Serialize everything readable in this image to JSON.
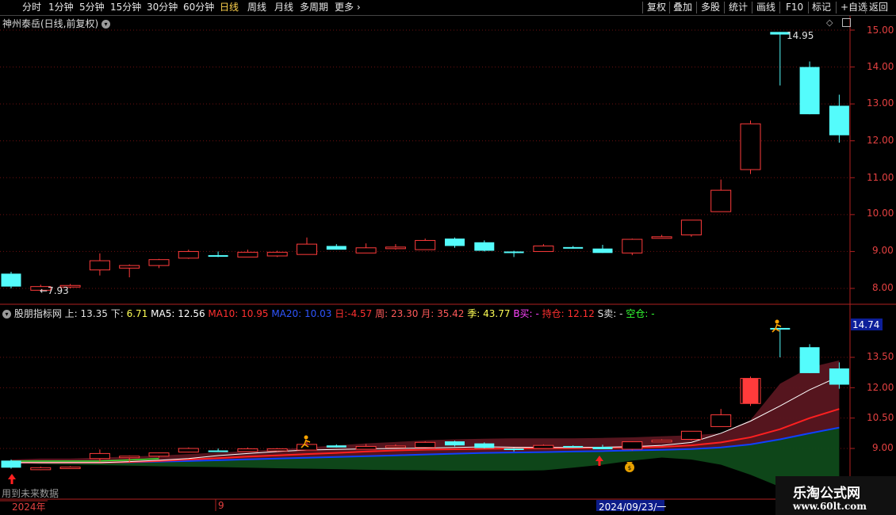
{
  "toolbar": {
    "periods": [
      "分时",
      "1分钟",
      "5分钟",
      "15分钟",
      "30分钟",
      "60分钟",
      "日线",
      "周线",
      "月线",
      "多周期",
      "更多"
    ],
    "active_period": "日线",
    "more_arrow": "›",
    "actions": [
      "复权",
      "叠加",
      "多股",
      "统计",
      "画线",
      "F10",
      "+自选",
      "返回"
    ],
    "mark_label": "标记"
  },
  "main_panel": {
    "title": "神州泰岳(日线,前复权)",
    "high_label": "14.95",
    "low_label": "←7.93",
    "y_ticks": [
      "15.00",
      "14.00",
      "13.00",
      "12.00",
      "11.00",
      "10.00",
      "9.00",
      "8.00"
    ]
  },
  "indicator_panel": {
    "name": "股朋指标网",
    "items": [
      {
        "k": "上:",
        "v": "13.35"
      },
      {
        "k": "下:",
        "v": "6.71"
      },
      {
        "k": "MA5:",
        "v": "12.56"
      },
      {
        "k": "MA10:",
        "v": "10.95"
      },
      {
        "k": "MA20:",
        "v": "10.03"
      },
      {
        "k": "日:",
        "v": "-4.57"
      },
      {
        "k": "周:",
        "v": "23.30"
      },
      {
        "k": "月:",
        "v": "35.42"
      },
      {
        "k": "季:",
        "v": "43.77"
      },
      {
        "k": "B买:",
        "v": "-"
      },
      {
        "k": "持仓:",
        "v": "12.12"
      },
      {
        "k": "S卖:",
        "v": "-"
      },
      {
        "k": "空仓:",
        "v": "-"
      }
    ],
    "current_price": "14.74",
    "y_ticks": [
      "13.50",
      "12.00",
      "10.50",
      "9.00"
    ],
    "footer_note": "用到未来数据"
  },
  "time_axis": {
    "year_label": "2024年",
    "month_label": "9",
    "date_label": "2024/09/23/一"
  },
  "watermark": {
    "title": "乐淘公式网",
    "url": "www.60lt.com"
  },
  "colors": {
    "up": "#ff3b3b",
    "down": "#54fcfc",
    "grid": "#6e1010",
    "ma5": "#ffffff",
    "ma10": "#ff2020",
    "ma20": "#1040ff"
  },
  "chart_data": {
    "type": "candlestick",
    "ylim": [
      7.6,
      15.3
    ],
    "candles": [
      {
        "o": 8.4,
        "c": 8.05,
        "h": 8.45,
        "l": 8.0
      },
      {
        "o": 7.95,
        "c": 8.05,
        "h": 8.1,
        "l": 7.93
      },
      {
        "o": 8.05,
        "c": 8.08,
        "h": 8.12,
        "l": 8.0
      },
      {
        "o": 8.5,
        "c": 8.75,
        "h": 8.95,
        "l": 8.35
      },
      {
        "o": 8.55,
        "c": 8.62,
        "h": 8.65,
        "l": 8.3
      },
      {
        "o": 8.62,
        "c": 8.78,
        "h": 8.8,
        "l": 8.55
      },
      {
        "o": 8.82,
        "c": 9.0,
        "h": 9.05,
        "l": 8.8
      },
      {
        "o": 8.9,
        "c": 8.86,
        "h": 9.0,
        "l": 8.85
      },
      {
        "o": 8.85,
        "c": 8.98,
        "h": 9.05,
        "l": 8.85
      },
      {
        "o": 8.88,
        "c": 8.98,
        "h": 9.02,
        "l": 8.85
      },
      {
        "o": 8.92,
        "c": 9.2,
        "h": 9.38,
        "l": 8.92
      },
      {
        "o": 9.15,
        "c": 9.05,
        "h": 9.2,
        "l": 9.05
      },
      {
        "o": 8.96,
        "c": 9.1,
        "h": 9.22,
        "l": 8.96
      },
      {
        "o": 9.08,
        "c": 9.12,
        "h": 9.2,
        "l": 9.05
      },
      {
        "o": 9.05,
        "c": 9.3,
        "h": 9.35,
        "l": 9.05
      },
      {
        "o": 9.35,
        "c": 9.15,
        "h": 9.38,
        "l": 9.1
      },
      {
        "o": 9.25,
        "c": 9.02,
        "h": 9.3,
        "l": 9.0
      },
      {
        "o": 9.0,
        "c": 8.98,
        "h": 9.02,
        "l": 8.85
      },
      {
        "o": 9.0,
        "c": 9.15,
        "h": 9.2,
        "l": 9.0
      },
      {
        "o": 9.12,
        "c": 9.1,
        "h": 9.15,
        "l": 9.08
      },
      {
        "o": 9.08,
        "c": 8.96,
        "h": 9.18,
        "l": 8.96
      },
      {
        "o": 8.96,
        "c": 9.33,
        "h": 9.35,
        "l": 8.9
      },
      {
        "o": 9.38,
        "c": 9.4,
        "h": 9.45,
        "l": 9.38
      },
      {
        "o": 9.45,
        "c": 9.85,
        "h": 9.85,
        "l": 9.4
      },
      {
        "o": 10.08,
        "c": 10.66,
        "h": 10.95,
        "l": 10.08
      },
      {
        "o": 11.22,
        "c": 12.46,
        "h": 12.55,
        "l": 11.1
      },
      {
        "o": 14.95,
        "c": 14.88,
        "h": 14.95,
        "l": 13.5
      },
      {
        "o": 14.0,
        "c": 12.72,
        "h": 14.15,
        "l": 12.72
      },
      {
        "o": 12.95,
        "c": 12.15,
        "h": 13.25,
        "l": 11.95
      }
    ],
    "indicator": {
      "ylim": [
        8.2,
        14.9
      ],
      "ma5": [
        8.3,
        8.3,
        8.3,
        8.3,
        8.35,
        8.42,
        8.5,
        8.65,
        8.75,
        8.85,
        8.92,
        8.95,
        8.98,
        9.0,
        9.02,
        9.05,
        9.08,
        9.06,
        9.05,
        9.05,
        9.06,
        9.09,
        9.15,
        9.3,
        9.75,
        10.35,
        11.1,
        11.9,
        12.56
      ],
      "ma10": [
        8.3,
        8.3,
        8.3,
        8.3,
        8.33,
        8.38,
        8.45,
        8.52,
        8.6,
        8.66,
        8.72,
        8.78,
        8.85,
        8.9,
        8.94,
        8.96,
        8.98,
        9.0,
        9.01,
        9.02,
        9.03,
        9.05,
        9.08,
        9.15,
        9.3,
        9.55,
        9.95,
        10.5,
        10.95
      ],
      "ma20": [
        8.3,
        8.3,
        8.3,
        8.3,
        8.32,
        8.35,
        8.38,
        8.42,
        8.46,
        8.5,
        8.54,
        8.58,
        8.62,
        8.66,
        8.7,
        8.74,
        8.78,
        8.8,
        8.82,
        8.85,
        8.87,
        8.9,
        8.93,
        8.97,
        9.05,
        9.2,
        9.45,
        9.75,
        10.03
      ],
      "upper": [
        8.45,
        8.5,
        8.5,
        8.55,
        8.6,
        8.65,
        8.72,
        8.8,
        8.88,
        8.95,
        9.05,
        9.15,
        9.25,
        9.32,
        9.4,
        9.45,
        9.48,
        9.5,
        9.5,
        9.5,
        9.52,
        9.55,
        9.6,
        9.65,
        9.75,
        10.4,
        12.2,
        13.0,
        13.35
      ],
      "lower": [
        8.3,
        8.22,
        8.2,
        8.18,
        8.15,
        8.12,
        8.1,
        8.08,
        8.05,
        8.02,
        8.0,
        7.98,
        7.95,
        7.93,
        7.92,
        7.9,
        7.9,
        7.9,
        7.92,
        8.05,
        8.2,
        8.4,
        8.55,
        8.45,
        8.2,
        7.7,
        7.1,
        6.71,
        6.71
      ]
    }
  }
}
